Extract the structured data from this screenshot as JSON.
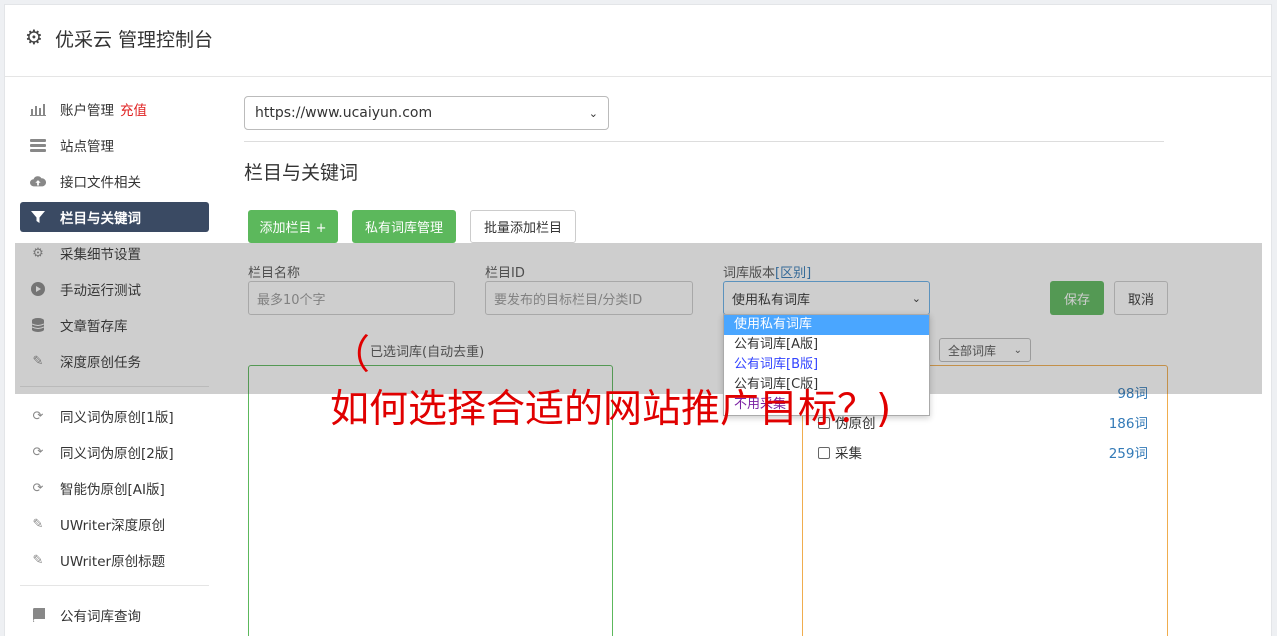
{
  "header": {
    "title": "优采云 管理控制台",
    "icon": "gear-icon"
  },
  "sidebar": {
    "items": [
      {
        "label": "账户管理",
        "badge": "充值",
        "icon": "bar-chart-icon"
      },
      {
        "label": "站点管理",
        "icon": "server-icon"
      },
      {
        "label": "接口文件相关",
        "icon": "cloud-upload-icon"
      },
      {
        "label": "栏目与关键词",
        "icon": "filter-icon",
        "active": true
      },
      {
        "label": "采集细节设置",
        "icon": "cogs-icon"
      },
      {
        "label": "手动运行测试",
        "icon": "play-icon"
      },
      {
        "label": "文章暂存库",
        "icon": "database-icon"
      },
      {
        "label": "深度原创任务",
        "icon": "edit-icon"
      }
    ],
    "items2": [
      {
        "label": "同义词伪原创[1版]",
        "icon": "refresh-icon"
      },
      {
        "label": "同义词伪原创[2版]",
        "icon": "refresh-icon"
      },
      {
        "label": "智能伪原创[AI版]",
        "icon": "refresh-icon"
      },
      {
        "label": "UWriter深度原创",
        "icon": "edit-icon"
      },
      {
        "label": "UWriter原创标题",
        "icon": "edit-icon"
      }
    ],
    "items3": [
      {
        "label": "公有词库查询",
        "icon": "book-icon"
      }
    ]
  },
  "main": {
    "site_select": "https://www.ucaiyun.com",
    "section_title": "栏目与关键词",
    "buttons": {
      "add_column": "添加栏目 +",
      "private_lib": "私有词库管理",
      "batch_add": "批量添加栏目"
    },
    "form": {
      "name_label": "栏目名称",
      "name_placeholder": "最多10个字",
      "id_label": "栏目ID",
      "id_placeholder": "要发布的目标栏目/分类ID",
      "version_label": "词库版本",
      "version_link": "[区别]",
      "version_value": "使用私有词库",
      "save": "保存",
      "cancel": "取消"
    },
    "dropdown_options": [
      "使用私有词库",
      "公有词库[A版]",
      "公有词库[B版]",
      "公有词库[C版]",
      "不用采集"
    ],
    "selected_caption": "已选词库(自动去重)",
    "filter_select": "全部词库",
    "libraries": [
      {
        "name": "",
        "count": "98词"
      },
      {
        "name": "伪原创",
        "count": "186词"
      },
      {
        "name": "采集",
        "count": "259词"
      }
    ]
  },
  "watermark": {
    "paren": "（",
    "text": "如何选择合适的网站推广目标？)"
  },
  "colors": {
    "active_nav": "#3a4a63",
    "green": "#5cb85c",
    "orange": "#f0ad4e",
    "red_text": "#e00000",
    "link": "#337ab7"
  }
}
